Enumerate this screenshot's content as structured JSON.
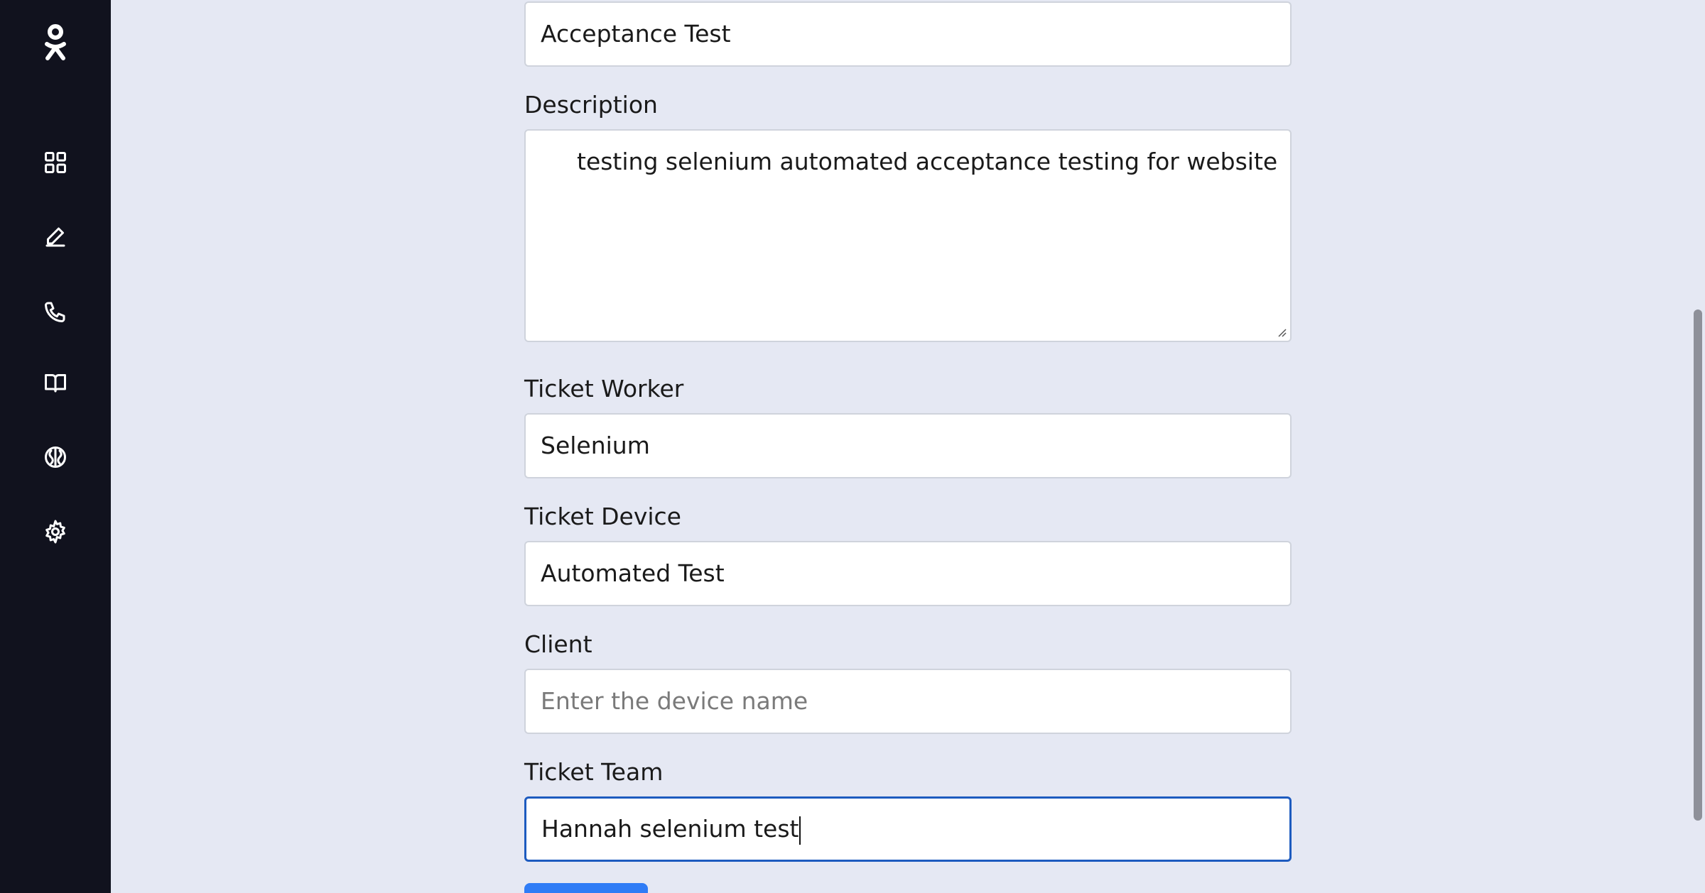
{
  "sidebar": {
    "logo": "ok-logo",
    "items": [
      {
        "icon": "grid-icon",
        "name": "dashboard"
      },
      {
        "icon": "pencil-icon",
        "name": "edit"
      },
      {
        "icon": "phone-icon",
        "name": "calls"
      },
      {
        "icon": "book-icon",
        "name": "knowledge"
      },
      {
        "icon": "brain-icon",
        "name": "ai"
      },
      {
        "icon": "gear-icon",
        "name": "settings"
      }
    ]
  },
  "form": {
    "title_value": "Acceptance Test",
    "description_label": "Description",
    "description_value": "testing selenium automated acceptance testing for website",
    "worker_label": "Ticket Worker",
    "worker_value": "Selenium",
    "device_label": "Ticket Device",
    "device_value": "Automated Test",
    "client_label": "Client",
    "client_placeholder": "Enter the device name",
    "team_label": "Ticket Team",
    "team_value": "Hannah selenium test"
  },
  "colors": {
    "background": "#e5e8f3",
    "sidebar": "#11121e",
    "focus_border": "#1d5bbf",
    "primary_button": "#2f7cf6"
  }
}
